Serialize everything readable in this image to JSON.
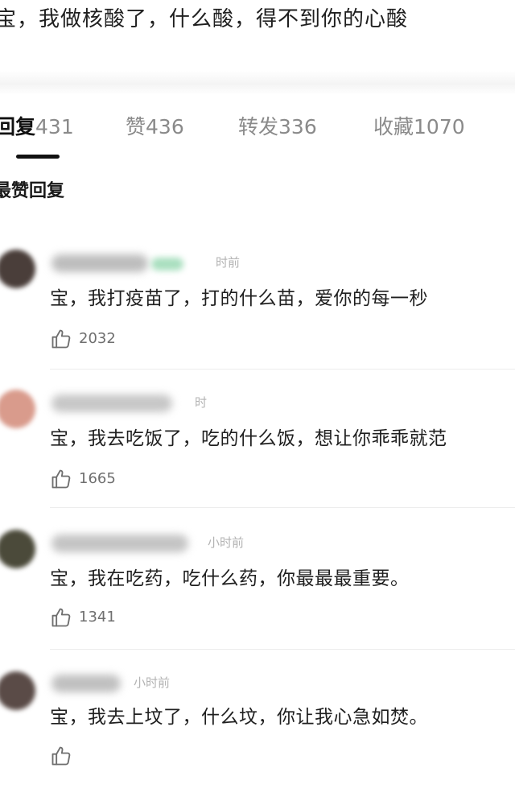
{
  "post": {
    "text": "宝，我做核酸了，什么酸，得不到你的心酸"
  },
  "tabs": [
    {
      "name": "回复",
      "count": "431",
      "active": true
    },
    {
      "name": "赞",
      "count": "436",
      "active": false
    },
    {
      "name": "转发",
      "count": "336",
      "active": false
    },
    {
      "name": "收藏",
      "count": "1070",
      "active": false
    }
  ],
  "section": {
    "title": "最赞回复"
  },
  "comments": [
    {
      "time": "时前",
      "text": "宝，我打疫苗了，打的什么苗，爱你的每一秒",
      "likes": "2032",
      "avatar_color": "#4a3e3a"
    },
    {
      "time": "时",
      "text": "宝，我去吃饭了，吃的什么饭，想让你乖乖就范",
      "likes": "1665",
      "avatar_color": "#d99b8c"
    },
    {
      "time": "小时前",
      "text": "宝，我在吃药，吃什么药，你最最最重要。",
      "likes": "1341",
      "avatar_color": "#4b4a3a"
    },
    {
      "time": "小时前",
      "text": "宝，我去上坟了，什么坟，你让我心急如焚。",
      "likes": "",
      "avatar_color": "#5a4b47"
    }
  ],
  "icons": {
    "like": "thumbs-up-icon"
  },
  "colors": {
    "text_primary": "#1f1f1f",
    "text_secondary": "#8a8a8a",
    "active_indicator": "#111111",
    "background": "#ffffff"
  }
}
